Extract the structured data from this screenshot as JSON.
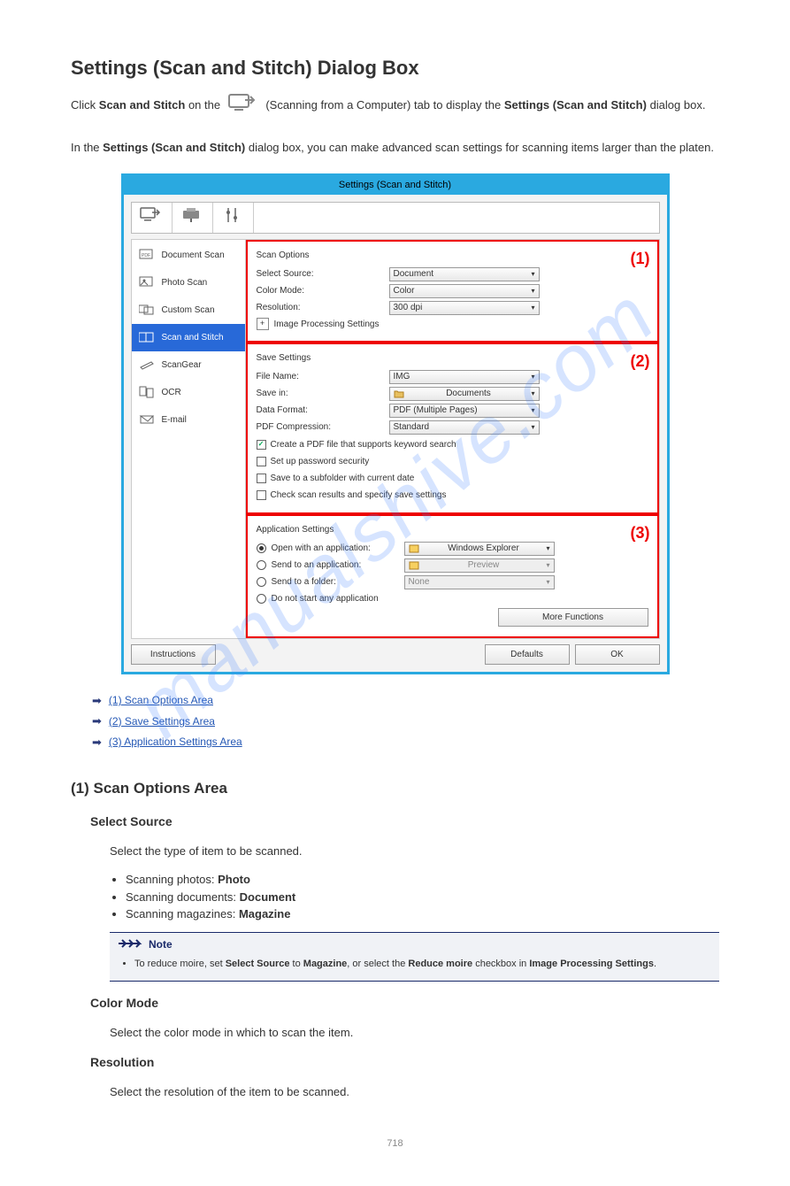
{
  "page_title": "Settings (Scan and Stitch) Dialog Box",
  "intro_pre": "Click ",
  "intro_mid": "Scan and Stitch",
  "intro_post1": " on the ",
  "intro_post2": " (Scanning from a Computer) tab to display the ",
  "intro_post3": "Settings (Scan and Stitch)",
  "intro_post4": " dialog box.",
  "intro_para2_a": "In the ",
  "intro_para2_b": "Settings (Scan and Stitch)",
  "intro_para2_c": " dialog box, you can make advanced scan settings for scanning items larger than the platen.",
  "dialog": {
    "title": "Settings (Scan and Stitch)",
    "sidebar": {
      "items": [
        {
          "label": "Document Scan"
        },
        {
          "label": "Photo Scan"
        },
        {
          "label": "Custom Scan"
        },
        {
          "label": "Scan and Stitch"
        },
        {
          "label": "ScanGear"
        },
        {
          "label": "OCR"
        },
        {
          "label": "E-mail"
        }
      ]
    },
    "section1": {
      "num": "(1)",
      "title": "Scan Options",
      "select_source_lbl": "Select Source:",
      "select_source_val": "Document",
      "color_mode_lbl": "Color Mode:",
      "color_mode_val": "Color",
      "resolution_lbl": "Resolution:",
      "resolution_val": "300 dpi",
      "imgproc": "Image Processing Settings"
    },
    "section2": {
      "num": "(2)",
      "title": "Save Settings",
      "filename_lbl": "File Name:",
      "filename_val": "IMG",
      "savein_lbl": "Save in:",
      "savein_val": "Documents",
      "dataformat_lbl": "Data Format:",
      "dataformat_val": "PDF (Multiple Pages)",
      "pdfcomp_lbl": "PDF Compression:",
      "pdfcomp_val": "Standard",
      "chk_keyword": "Create a PDF file that supports keyword search",
      "chk_password": "Set up password security",
      "chk_subfolder": "Save to a subfolder with current date",
      "chk_checkresults": "Check scan results and specify save settings"
    },
    "section3": {
      "num": "(3)",
      "title": "Application Settings",
      "r_openapp_lbl": "Open with an application:",
      "r_openapp_val": "Windows Explorer",
      "r_sendapp_lbl": "Send to an application:",
      "r_sendapp_val": "Preview",
      "r_sendfolder_lbl": "Send to a folder:",
      "r_sendfolder_val": "None",
      "r_donotstart": "Do not start any application",
      "more_btn": "More Functions"
    },
    "instructions_btn": "Instructions",
    "defaults_btn": "Defaults",
    "ok_btn": "OK"
  },
  "links": [
    "(1) Scan Options Area",
    "(2) Save Settings Area",
    "(3) Application Settings Area"
  ],
  "h2_1": "(1) Scan Options Area",
  "h3_selectsource": "Select Source",
  "selectsource_desc": "Select the type of item to be scanned.",
  "ss_opts": [
    {
      "a": "Scanning photos:",
      "b": "Photo"
    },
    {
      "a": "Scanning documents:",
      "b": "Document"
    },
    {
      "a": "Scanning magazines:",
      "b": "Magazine"
    }
  ],
  "note_label": "Note",
  "note_li_a": "To reduce moire, set ",
  "note_li_b": "Select Source",
  "note_li_c": " to ",
  "note_li_d": "Magazine",
  "note_li_e": ", or select the ",
  "note_li_f": "Reduce moire",
  "note_li_g": " checkbox in ",
  "note_li_h": "Image Processing Settings",
  "note_li_i": ".",
  "h3_colormode": "Color Mode",
  "colormode_desc": "Select the color mode in which to scan the item.",
  "h3_resolution": "Resolution",
  "resolution_desc": "Select the resolution of the item to be scanned.",
  "page_number": "718"
}
